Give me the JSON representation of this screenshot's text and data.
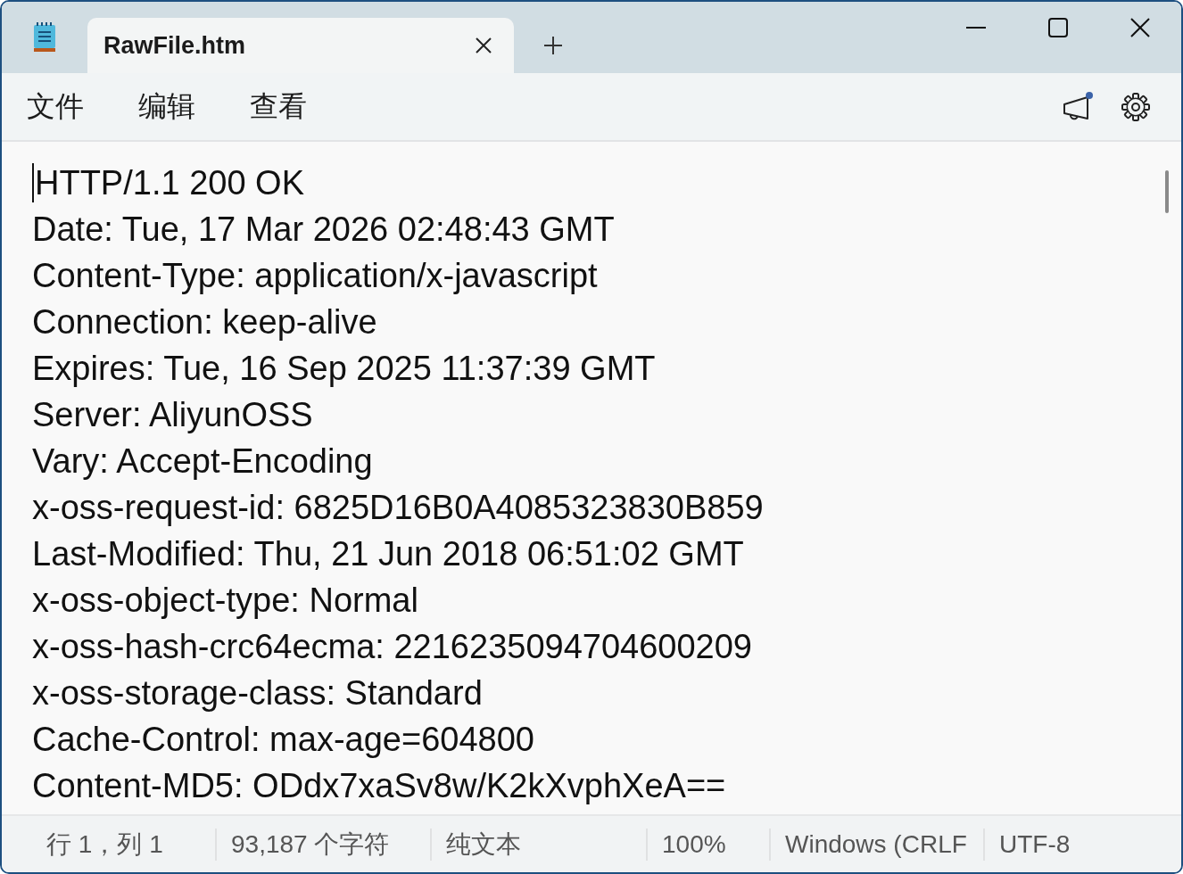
{
  "tabs": [
    {
      "label": "RawFile.htm",
      "selected": true
    }
  ],
  "menu": [
    "文件",
    "编辑",
    "查看"
  ],
  "toolbar": {
    "feedback_unread": true
  },
  "editor": {
    "lines": [
      "HTTP/1.1 200 OK",
      "Date: Tue, 17 Mar 2026 02:48:43 GMT",
      "Content-Type: application/x-javascript",
      "Connection: keep-alive",
      "Expires: Tue, 16 Sep 2025 11:37:39 GMT",
      "Server: AliyunOSS",
      "Vary: Accept-Encoding",
      "x-oss-request-id: 6825D16B0A4085323830B859",
      "Last-Modified: Thu, 21 Jun 2018 06:51:02 GMT",
      "x-oss-object-type: Normal",
      "x-oss-hash-crc64ecma: 2216235094704600209",
      "x-oss-storage-class: Standard",
      "Cache-Control: max-age=604800",
      "Content-MD5: ODdx7xaSv8w/K2kXvphXeA=="
    ]
  },
  "status_bar": [
    "行 1，列 1",
    "93,187 个字符",
    "纯文本",
    "100%",
    "Windows (CRLF",
    "UTF-8"
  ]
}
